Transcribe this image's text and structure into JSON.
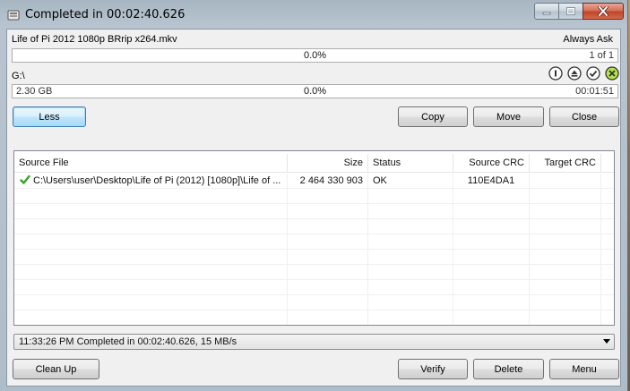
{
  "window": {
    "title": "Completed in 00:02:40.626"
  },
  "transfer": {
    "source_file_name": "Life of Pi 2012 1080p BRrip x264.mkv",
    "overwrite_mode": "Always Ask",
    "file_progress_text": "0.0%",
    "file_counter": "1 of 1",
    "destination": "G:\\",
    "total_size": "2.30 GB",
    "total_progress_text": "0.0%",
    "elapsed_time": "00:01:51"
  },
  "buttons": {
    "less": "Less",
    "copy": "Copy",
    "move": "Move",
    "close": "Close",
    "clean_up": "Clean Up",
    "verify": "Verify",
    "delete": "Delete",
    "menu": "Menu"
  },
  "table": {
    "columns": [
      "Source File",
      "Size",
      "Status",
      "Source CRC",
      "Target CRC"
    ],
    "rows": [
      {
        "source_file": "C:\\Users\\user\\Desktop\\Life of Pi (2012) [1080p]\\Life of ...",
        "size": "2 464 330 903",
        "status": "OK",
        "source_crc": "110E4DA1",
        "target_crc": ""
      }
    ]
  },
  "status_line": "11:33:26 PM Completed in 00:02:40.626, 15 MB/s",
  "colors": {
    "check_green": "#3aa22c",
    "accent_blue": "#3c7fb1",
    "close_red": "#c2442a"
  },
  "icons": {
    "app": "copy-app-icon",
    "pause": "pause-icon",
    "eject": "eject-icon",
    "check": "check-circle-icon",
    "cancel": "cancel-circle-icon",
    "row_status": "checkmark-icon"
  }
}
